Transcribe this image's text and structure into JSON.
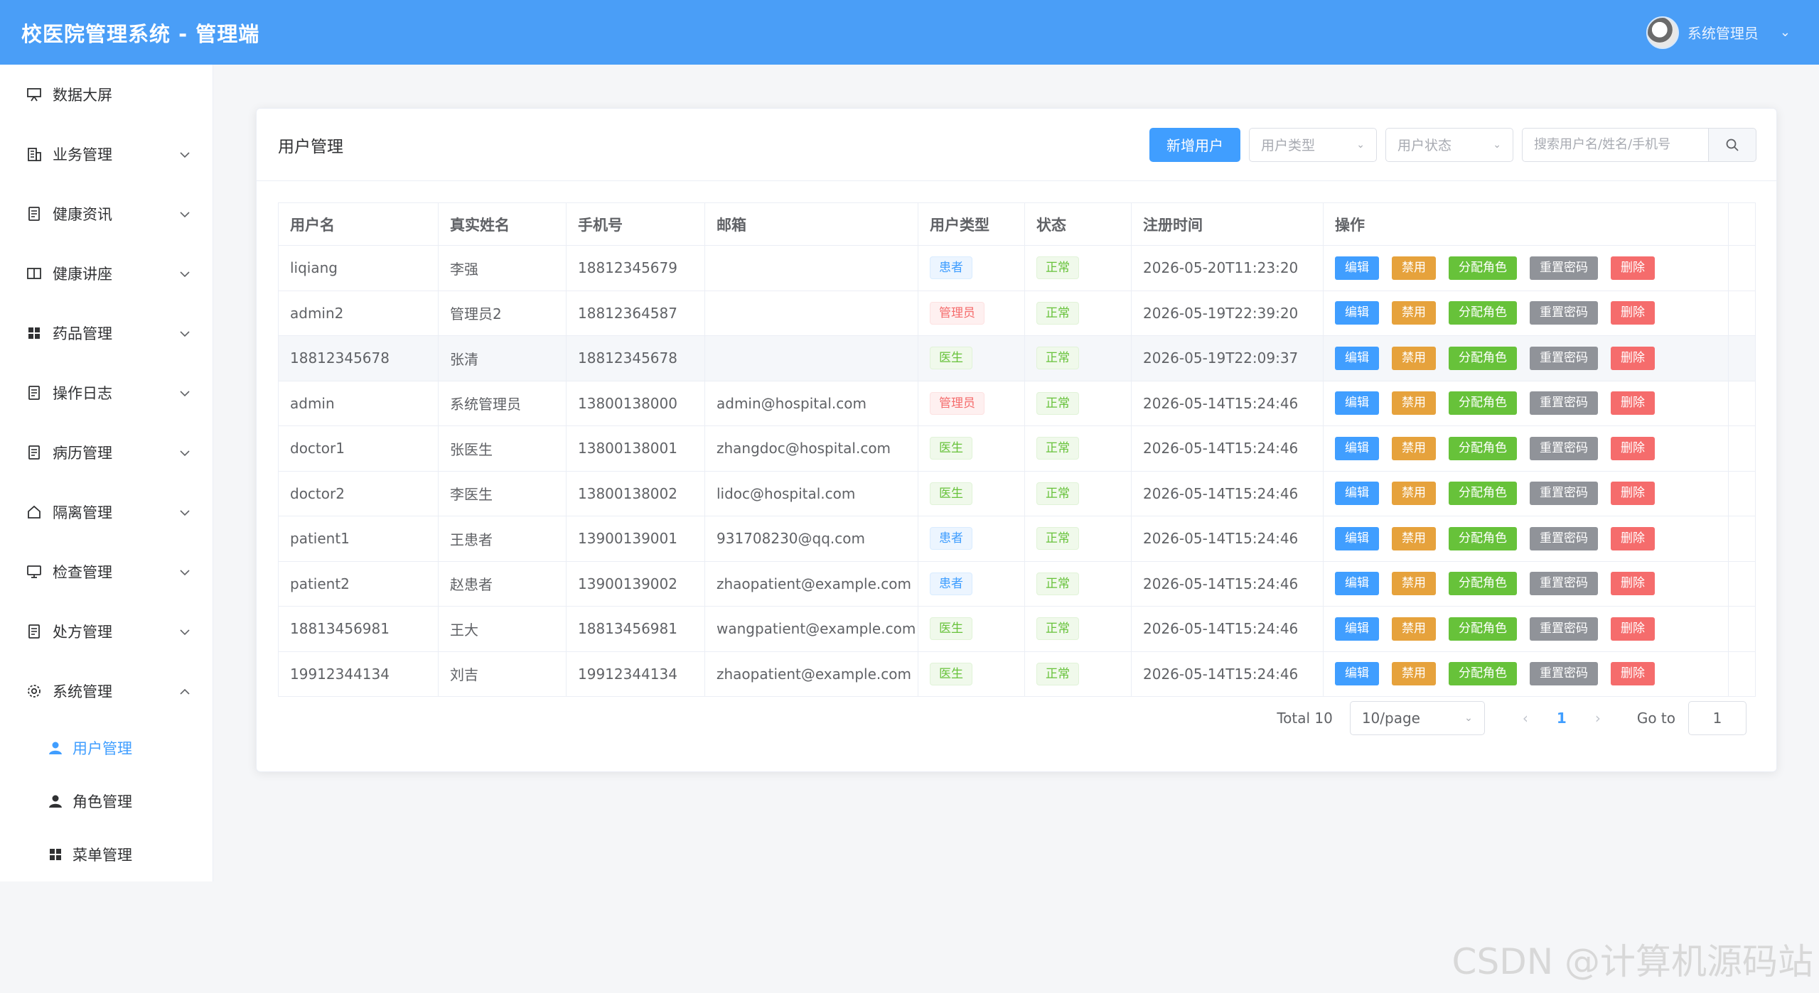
{
  "header": {
    "title": "校医院管理系统 - 管理端",
    "user_name": "系统管理员"
  },
  "sidebar": {
    "items": [
      {
        "label": "数据大屏",
        "icon": "presentation-icon",
        "expandable": false
      },
      {
        "label": "业务管理",
        "icon": "building-icon",
        "expandable": true
      },
      {
        "label": "健康资讯",
        "icon": "document-icon",
        "expandable": true
      },
      {
        "label": "健康讲座",
        "icon": "book-icon",
        "expandable": true
      },
      {
        "label": "药品管理",
        "icon": "grid-icon",
        "expandable": true
      },
      {
        "label": "操作日志",
        "icon": "document-icon",
        "expandable": true
      },
      {
        "label": "病历管理",
        "icon": "document-icon",
        "expandable": true
      },
      {
        "label": "隔离管理",
        "icon": "house-icon",
        "expandable": true
      },
      {
        "label": "检查管理",
        "icon": "monitor-icon",
        "expandable": true
      },
      {
        "label": "处方管理",
        "icon": "document-icon",
        "expandable": true
      },
      {
        "label": "系统管理",
        "icon": "gear-icon",
        "expandable": true,
        "expanded": true
      }
    ],
    "submenu": [
      {
        "label": "用户管理",
        "icon": "user-icon",
        "active": true
      },
      {
        "label": "角色管理",
        "icon": "user-icon",
        "active": false
      },
      {
        "label": "菜单管理",
        "icon": "grid-icon",
        "active": false
      }
    ]
  },
  "card": {
    "title": "用户管理",
    "add_button": "新增用户",
    "filter_type_placeholder": "用户类型",
    "filter_status_placeholder": "用户状态",
    "search_placeholder": "搜索用户名/姓名/手机号"
  },
  "table": {
    "columns": [
      "用户名",
      "真实姓名",
      "手机号",
      "邮箱",
      "用户类型",
      "状态",
      "注册时间",
      "操作"
    ],
    "actions": {
      "edit": "编辑",
      "disable": "禁用",
      "assign_role": "分配角色",
      "reset_password": "重置密码",
      "delete": "删除"
    },
    "rows": [
      {
        "username": "liqiang",
        "realname": "李强",
        "phone": "18812345679",
        "email": "",
        "type": "患者",
        "type_color": "blue",
        "status": "正常",
        "created": "2026-05-20T11:23:20"
      },
      {
        "username": "admin2",
        "realname": "管理员2",
        "phone": "18812364587",
        "email": "",
        "type": "管理员",
        "type_color": "red",
        "status": "正常",
        "created": "2026-05-19T22:39:20"
      },
      {
        "username": "18812345678",
        "realname": "张清",
        "phone": "18812345678",
        "email": "",
        "type": "医生",
        "type_color": "green",
        "status": "正常",
        "created": "2026-05-19T22:09:37"
      },
      {
        "username": "admin",
        "realname": "系统管理员",
        "phone": "13800138000",
        "email": "admin@hospital.com",
        "type": "管理员",
        "type_color": "red",
        "status": "正常",
        "created": "2026-05-14T15:24:46"
      },
      {
        "username": "doctor1",
        "realname": "张医生",
        "phone": "13800138001",
        "email": "zhangdoc@hospital.com",
        "type": "医生",
        "type_color": "green",
        "status": "正常",
        "created": "2026-05-14T15:24:46"
      },
      {
        "username": "doctor2",
        "realname": "李医生",
        "phone": "13800138002",
        "email": "lidoc@hospital.com",
        "type": "医生",
        "type_color": "green",
        "status": "正常",
        "created": "2026-05-14T15:24:46"
      },
      {
        "username": "patient1",
        "realname": "王患者",
        "phone": "13900139001",
        "email": "931708230@qq.com",
        "type": "患者",
        "type_color": "blue",
        "status": "正常",
        "created": "2026-05-14T15:24:46"
      },
      {
        "username": "patient2",
        "realname": "赵患者",
        "phone": "13900139002",
        "email": "zhaopatient@example.com",
        "type": "患者",
        "type_color": "blue",
        "status": "正常",
        "created": "2026-05-14T15:24:46"
      },
      {
        "username": "18813456981",
        "realname": "王大",
        "phone": "18813456981",
        "email": "wangpatient@example.com",
        "type": "医生",
        "type_color": "green",
        "status": "正常",
        "created": "2026-05-14T15:24:46"
      },
      {
        "username": "19912344134",
        "realname": "刘吉",
        "phone": "19912344134",
        "email": "zhaopatient@example.com",
        "type": "医生",
        "type_color": "green",
        "status": "正常",
        "created": "2026-05-14T15:24:46"
      }
    ]
  },
  "pagination": {
    "total_label": "Total 10",
    "page_size": "10/page",
    "current_page": "1",
    "goto_label": "Go to",
    "goto_value": "1"
  },
  "watermark": "CSDN @计算机源码站"
}
